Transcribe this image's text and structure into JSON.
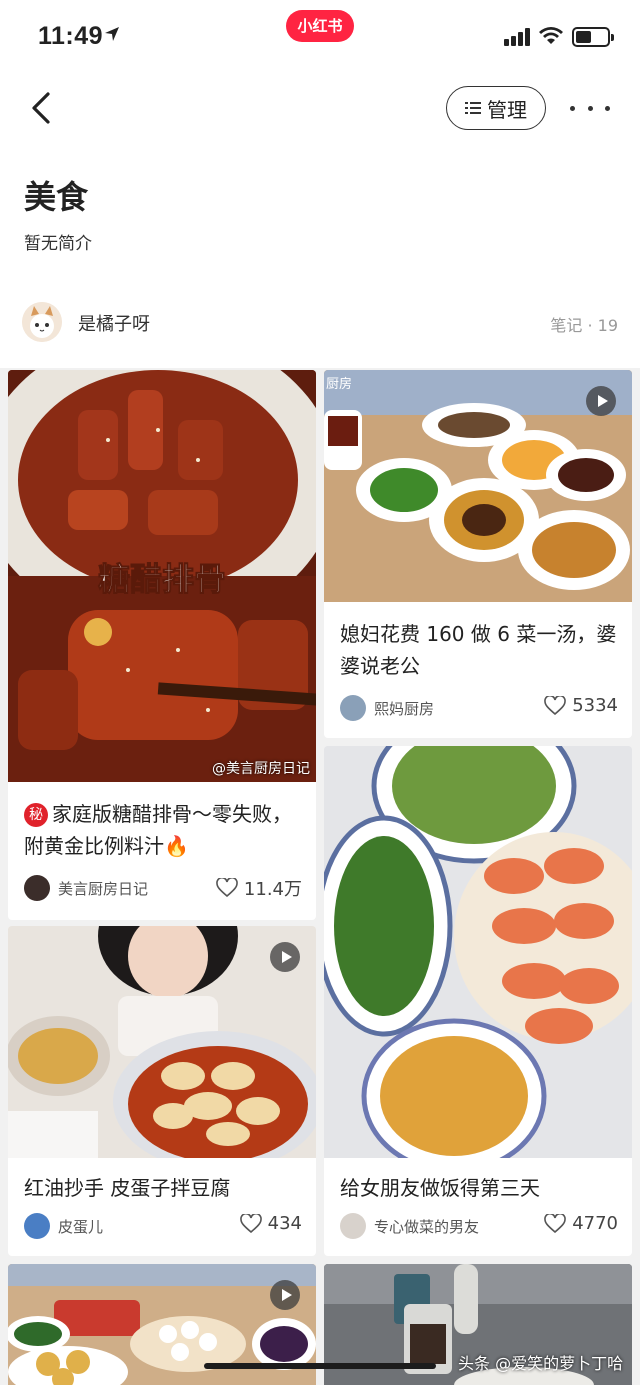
{
  "status": {
    "time": "11:49"
  },
  "brand": "小红书",
  "header": {
    "manage_label": "管理"
  },
  "board": {
    "title": "美食",
    "intro": "暂无简介"
  },
  "author": {
    "name": "是橘子呀",
    "notes": "笔记 · 19"
  },
  "notes": [
    {
      "title": "家庭版糖醋排骨～零失败，附黄金比例料汁",
      "secret_badge": "秘",
      "emoji": "🔥",
      "img_text": "糖醋排骨",
      "img_watermark": "@美言厨房日记",
      "author": "美言厨房日记",
      "likes": "11.4万"
    },
    {
      "title": "媳妇花费 160 做 6 菜一汤，婆婆说老公",
      "img_tag": "厨房",
      "author": "熙妈厨房",
      "likes": "5334"
    },
    {
      "title": "红油抄手 皮蛋子拌豆腐",
      "author": "皮蛋儿",
      "likes": "434"
    },
    {
      "title": "给女朋友做饭得第三天",
      "author": "专心做菜的男友",
      "likes": "4770"
    }
  ],
  "watermark": "头条 @爱笑的萝卜丁哈",
  "colors": {
    "brand": "#ff2442",
    "secret": "#e0222b"
  }
}
